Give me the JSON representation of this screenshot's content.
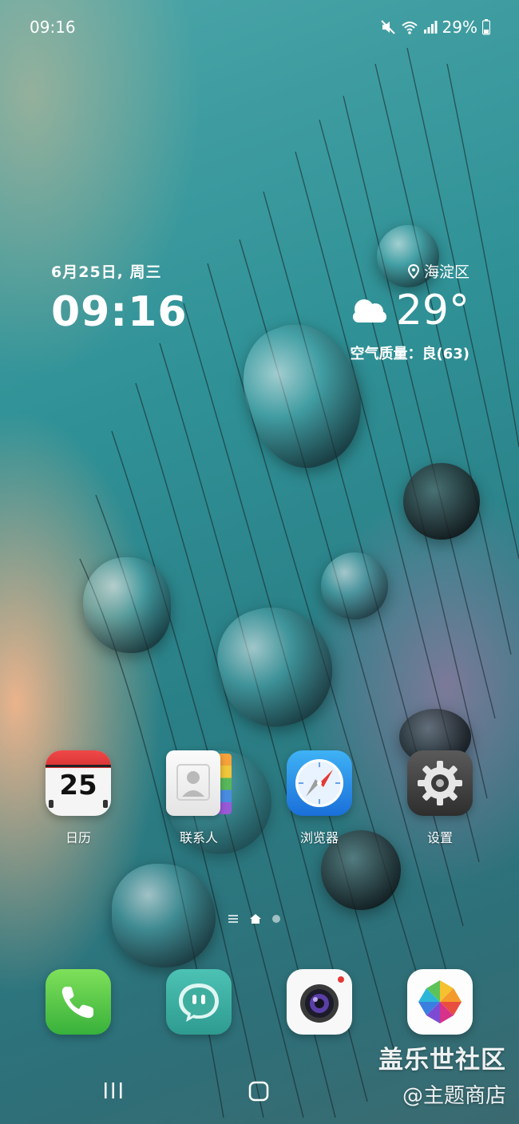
{
  "status_bar": {
    "time": "09:16",
    "battery": "29%"
  },
  "clock_widget": {
    "date": "6月25日, 周三",
    "time": "09:16"
  },
  "weather_widget": {
    "location": "海淀区",
    "temperature": "29°",
    "air_quality": "空气质量：良(63)"
  },
  "apps": [
    {
      "label": "日历",
      "icon": "calendar-icon",
      "day": "25"
    },
    {
      "label": "联系人",
      "icon": "contacts-icon"
    },
    {
      "label": "浏览器",
      "icon": "browser-compass-icon"
    },
    {
      "label": "设置",
      "icon": "gear-icon"
    }
  ],
  "dock": [
    {
      "icon": "phone-icon"
    },
    {
      "icon": "messages-icon"
    },
    {
      "icon": "camera-icon"
    },
    {
      "icon": "gallery-pinwheel-icon"
    }
  ],
  "watermark": {
    "line1": "盖乐世社区",
    "line2": "@主题商店"
  }
}
